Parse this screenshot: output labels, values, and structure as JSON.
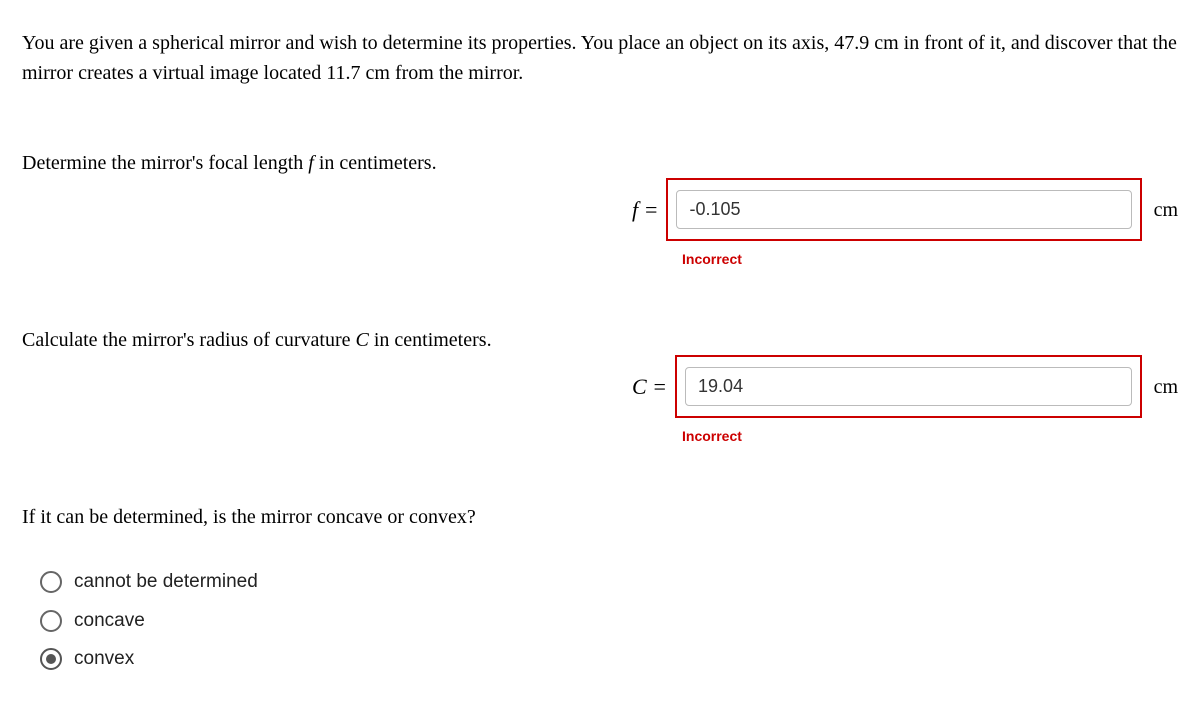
{
  "problem": {
    "text": "You are given a spherical mirror and wish to determine its properties. You place an object on its axis, 47.9 cm in front of it, and discover that the mirror creates a virtual image located 11.7 cm from the mirror."
  },
  "q1": {
    "prompt_pre": "Determine the mirror's focal length ",
    "prompt_var": "f",
    "prompt_post": " in centimeters.",
    "var_label": "f =",
    "value": "-0.105",
    "unit": "cm",
    "feedback": "Incorrect"
  },
  "q2": {
    "prompt_pre": "Calculate the mirror's radius of curvature ",
    "prompt_var": "C",
    "prompt_post": " in centimeters.",
    "var_label": "C =",
    "value": "19.04",
    "unit": "cm",
    "feedback": "Incorrect"
  },
  "q3": {
    "prompt": "If it can be determined, is the mirror concave or convex?",
    "options": [
      {
        "label": "cannot be determined",
        "selected": false
      },
      {
        "label": "concave",
        "selected": false
      },
      {
        "label": "convex",
        "selected": true
      }
    ]
  }
}
